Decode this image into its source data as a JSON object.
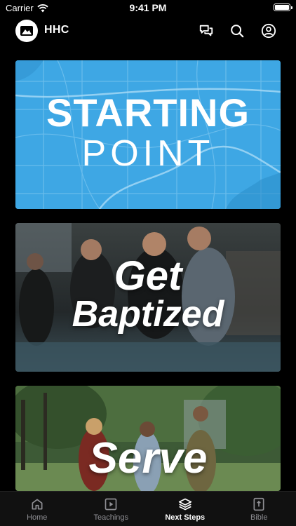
{
  "status_bar": {
    "carrier": "Carrier",
    "time": "9:41 PM"
  },
  "header": {
    "title": "HHC",
    "icons": [
      "chat-icon",
      "search-icon",
      "profile-icon"
    ]
  },
  "cards": [
    {
      "line1": "STARTING",
      "line2": "POINT",
      "background": "#3ea7e4"
    },
    {
      "line1": "Get",
      "line2": "Baptized"
    },
    {
      "line1": "Serve"
    }
  ],
  "tabs": [
    {
      "label": "Home",
      "icon": "home-icon",
      "active": false
    },
    {
      "label": "Teachings",
      "icon": "play-icon",
      "active": false
    },
    {
      "label": "Next Steps",
      "icon": "layers-icon",
      "active": true
    },
    {
      "label": "Bible",
      "icon": "bible-icon",
      "active": false
    }
  ]
}
